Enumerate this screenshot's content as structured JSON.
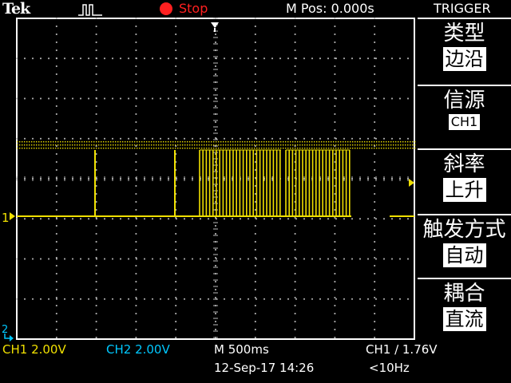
{
  "header": {
    "brand": "Tek",
    "acquire_icon": "pulse-icon",
    "run_state": "Stop",
    "run_state_color": "#ff2020",
    "time_position": "M Pos: 0.000s",
    "menu_title": "TRIGGER"
  },
  "menu": {
    "items": [
      {
        "label": "类型",
        "value": "边沿"
      },
      {
        "label": "信源",
        "value": "CH1"
      },
      {
        "label": "斜率",
        "value": "上升"
      },
      {
        "label": "触发方式",
        "value": "自动"
      },
      {
        "label": "耦合",
        "value": "直流"
      }
    ]
  },
  "footer": {
    "ch1_scale": "CH1  2.00V",
    "ch2_scale": "CH2  2.00V",
    "timebase": "M 500ms",
    "trigger_readout": "CH1 ∕ 1.76V",
    "datetime": "12-Sep-17 14:26",
    "frequency": "<10Hz"
  },
  "markers": {
    "ch1": "1",
    "ch2": "2"
  },
  "colors": {
    "ch1": "#f0e000",
    "ch2": "#00c8ff",
    "grid": "#ffffff",
    "accent": "#ff2020"
  }
}
